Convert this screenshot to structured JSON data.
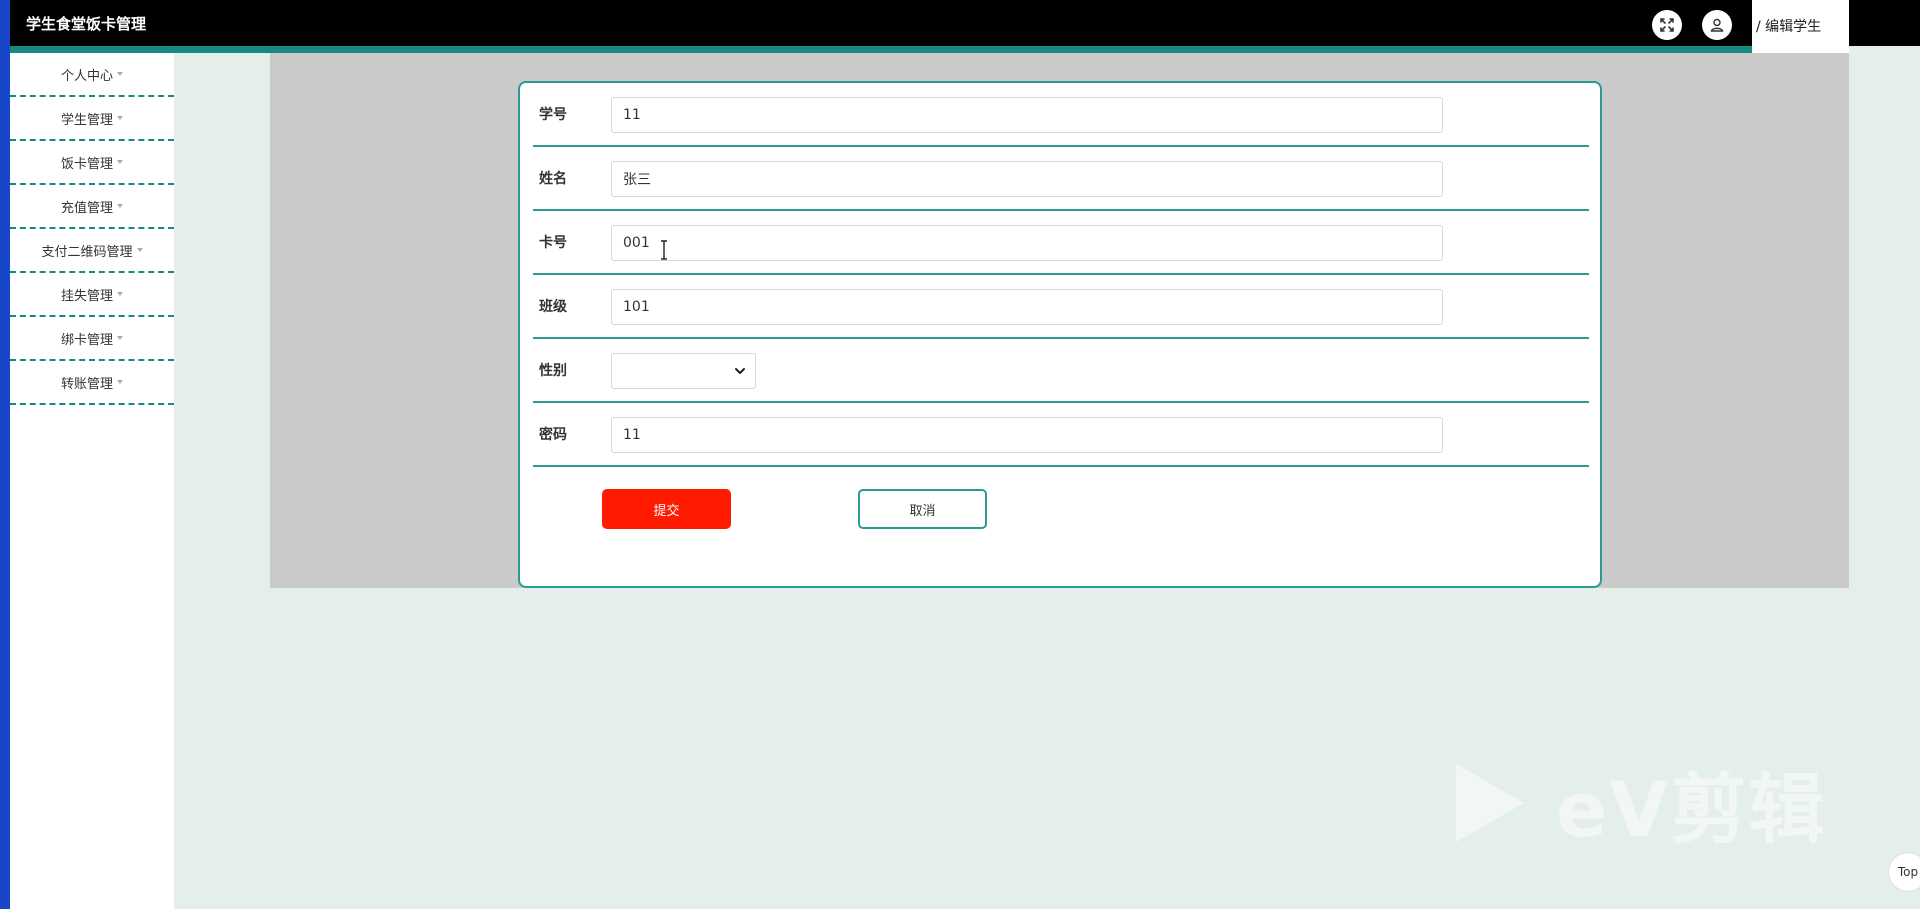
{
  "app": {
    "title": "学生食堂饭卡管理"
  },
  "header": {
    "fullscreen_icon": "fullscreen-icon",
    "user_icon": "user-icon",
    "breadcrumb": "/ 编辑学生"
  },
  "sidebar": {
    "items": [
      {
        "label": "个人中心"
      },
      {
        "label": "学生管理"
      },
      {
        "label": "饭卡管理"
      },
      {
        "label": "充值管理"
      },
      {
        "label": "支付二维码管理"
      },
      {
        "label": "挂失管理"
      },
      {
        "label": "绑卡管理"
      },
      {
        "label": "转账管理"
      }
    ]
  },
  "form": {
    "fields": [
      {
        "label": "学号",
        "value": "11"
      },
      {
        "label": "姓名",
        "value": "张三"
      },
      {
        "label": "卡号",
        "value": "001"
      },
      {
        "label": "班级",
        "value": "101"
      },
      {
        "label": "性别",
        "value": ""
      },
      {
        "label": "密码",
        "value": "11"
      }
    ],
    "submit_label": "提交",
    "cancel_label": "取消"
  },
  "watermark": {
    "text": "eV剪辑"
  },
  "scroll_top": {
    "label": "Top"
  },
  "colors": {
    "accent": "#168a82",
    "submit": "#ff1a00",
    "left_strip": "#1746c9",
    "background": "#e3efe8"
  }
}
